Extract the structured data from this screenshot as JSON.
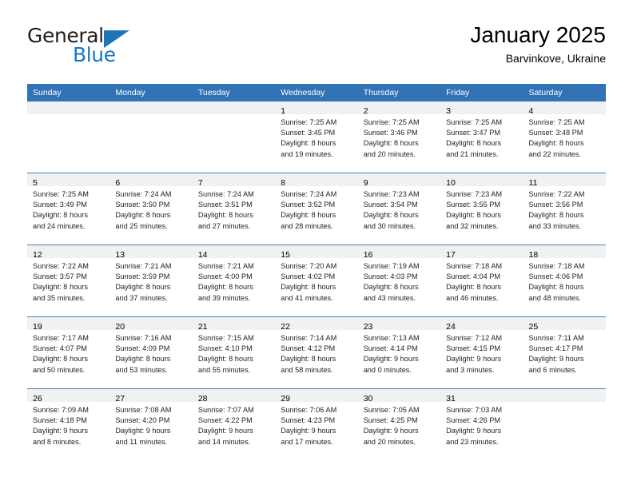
{
  "brand": {
    "word1": "General",
    "word2": "Blue",
    "accent_color": "#1b75bb",
    "triangle_icon": "brand-triangle-icon"
  },
  "header": {
    "title": "January 2025",
    "subtitle": "Barvinkove, Ukraine"
  },
  "theme": {
    "header_bg": "#3273b5",
    "daynum_band": "#f1f1f1",
    "row_divider": "#4a7fb5",
    "text": "#231f20"
  },
  "weekday_headers": [
    "Sunday",
    "Monday",
    "Tuesday",
    "Wednesday",
    "Thursday",
    "Friday",
    "Saturday"
  ],
  "weeks": [
    [
      {
        "day": "",
        "lines": []
      },
      {
        "day": "",
        "lines": []
      },
      {
        "day": "",
        "lines": []
      },
      {
        "day": "1",
        "lines": [
          "Sunrise: 7:25 AM",
          "Sunset: 3:45 PM",
          "Daylight: 8 hours",
          "and 19 minutes."
        ]
      },
      {
        "day": "2",
        "lines": [
          "Sunrise: 7:25 AM",
          "Sunset: 3:46 PM",
          "Daylight: 8 hours",
          "and 20 minutes."
        ]
      },
      {
        "day": "3",
        "lines": [
          "Sunrise: 7:25 AM",
          "Sunset: 3:47 PM",
          "Daylight: 8 hours",
          "and 21 minutes."
        ]
      },
      {
        "day": "4",
        "lines": [
          "Sunrise: 7:25 AM",
          "Sunset: 3:48 PM",
          "Daylight: 8 hours",
          "and 22 minutes."
        ]
      }
    ],
    [
      {
        "day": "5",
        "lines": [
          "Sunrise: 7:25 AM",
          "Sunset: 3:49 PM",
          "Daylight: 8 hours",
          "and 24 minutes."
        ]
      },
      {
        "day": "6",
        "lines": [
          "Sunrise: 7:24 AM",
          "Sunset: 3:50 PM",
          "Daylight: 8 hours",
          "and 25 minutes."
        ]
      },
      {
        "day": "7",
        "lines": [
          "Sunrise: 7:24 AM",
          "Sunset: 3:51 PM",
          "Daylight: 8 hours",
          "and 27 minutes."
        ]
      },
      {
        "day": "8",
        "lines": [
          "Sunrise: 7:24 AM",
          "Sunset: 3:52 PM",
          "Daylight: 8 hours",
          "and 28 minutes."
        ]
      },
      {
        "day": "9",
        "lines": [
          "Sunrise: 7:23 AM",
          "Sunset: 3:54 PM",
          "Daylight: 8 hours",
          "and 30 minutes."
        ]
      },
      {
        "day": "10",
        "lines": [
          "Sunrise: 7:23 AM",
          "Sunset: 3:55 PM",
          "Daylight: 8 hours",
          "and 32 minutes."
        ]
      },
      {
        "day": "11",
        "lines": [
          "Sunrise: 7:22 AM",
          "Sunset: 3:56 PM",
          "Daylight: 8 hours",
          "and 33 minutes."
        ]
      }
    ],
    [
      {
        "day": "12",
        "lines": [
          "Sunrise: 7:22 AM",
          "Sunset: 3:57 PM",
          "Daylight: 8 hours",
          "and 35 minutes."
        ]
      },
      {
        "day": "13",
        "lines": [
          "Sunrise: 7:21 AM",
          "Sunset: 3:59 PM",
          "Daylight: 8 hours",
          "and 37 minutes."
        ]
      },
      {
        "day": "14",
        "lines": [
          "Sunrise: 7:21 AM",
          "Sunset: 4:00 PM",
          "Daylight: 8 hours",
          "and 39 minutes."
        ]
      },
      {
        "day": "15",
        "lines": [
          "Sunrise: 7:20 AM",
          "Sunset: 4:02 PM",
          "Daylight: 8 hours",
          "and 41 minutes."
        ]
      },
      {
        "day": "16",
        "lines": [
          "Sunrise: 7:19 AM",
          "Sunset: 4:03 PM",
          "Daylight: 8 hours",
          "and 43 minutes."
        ]
      },
      {
        "day": "17",
        "lines": [
          "Sunrise: 7:18 AM",
          "Sunset: 4:04 PM",
          "Daylight: 8 hours",
          "and 46 minutes."
        ]
      },
      {
        "day": "18",
        "lines": [
          "Sunrise: 7:18 AM",
          "Sunset: 4:06 PM",
          "Daylight: 8 hours",
          "and 48 minutes."
        ]
      }
    ],
    [
      {
        "day": "19",
        "lines": [
          "Sunrise: 7:17 AM",
          "Sunset: 4:07 PM",
          "Daylight: 8 hours",
          "and 50 minutes."
        ]
      },
      {
        "day": "20",
        "lines": [
          "Sunrise: 7:16 AM",
          "Sunset: 4:09 PM",
          "Daylight: 8 hours",
          "and 53 minutes."
        ]
      },
      {
        "day": "21",
        "lines": [
          "Sunrise: 7:15 AM",
          "Sunset: 4:10 PM",
          "Daylight: 8 hours",
          "and 55 minutes."
        ]
      },
      {
        "day": "22",
        "lines": [
          "Sunrise: 7:14 AM",
          "Sunset: 4:12 PM",
          "Daylight: 8 hours",
          "and 58 minutes."
        ]
      },
      {
        "day": "23",
        "lines": [
          "Sunrise: 7:13 AM",
          "Sunset: 4:14 PM",
          "Daylight: 9 hours",
          "and 0 minutes."
        ]
      },
      {
        "day": "24",
        "lines": [
          "Sunrise: 7:12 AM",
          "Sunset: 4:15 PM",
          "Daylight: 9 hours",
          "and 3 minutes."
        ]
      },
      {
        "day": "25",
        "lines": [
          "Sunrise: 7:11 AM",
          "Sunset: 4:17 PM",
          "Daylight: 9 hours",
          "and 6 minutes."
        ]
      }
    ],
    [
      {
        "day": "26",
        "lines": [
          "Sunrise: 7:09 AM",
          "Sunset: 4:18 PM",
          "Daylight: 9 hours",
          "and 8 minutes."
        ]
      },
      {
        "day": "27",
        "lines": [
          "Sunrise: 7:08 AM",
          "Sunset: 4:20 PM",
          "Daylight: 9 hours",
          "and 11 minutes."
        ]
      },
      {
        "day": "28",
        "lines": [
          "Sunrise: 7:07 AM",
          "Sunset: 4:22 PM",
          "Daylight: 9 hours",
          "and 14 minutes."
        ]
      },
      {
        "day": "29",
        "lines": [
          "Sunrise: 7:06 AM",
          "Sunset: 4:23 PM",
          "Daylight: 9 hours",
          "and 17 minutes."
        ]
      },
      {
        "day": "30",
        "lines": [
          "Sunrise: 7:05 AM",
          "Sunset: 4:25 PM",
          "Daylight: 9 hours",
          "and 20 minutes."
        ]
      },
      {
        "day": "31",
        "lines": [
          "Sunrise: 7:03 AM",
          "Sunset: 4:26 PM",
          "Daylight: 9 hours",
          "and 23 minutes."
        ]
      },
      {
        "day": "",
        "lines": []
      }
    ]
  ]
}
